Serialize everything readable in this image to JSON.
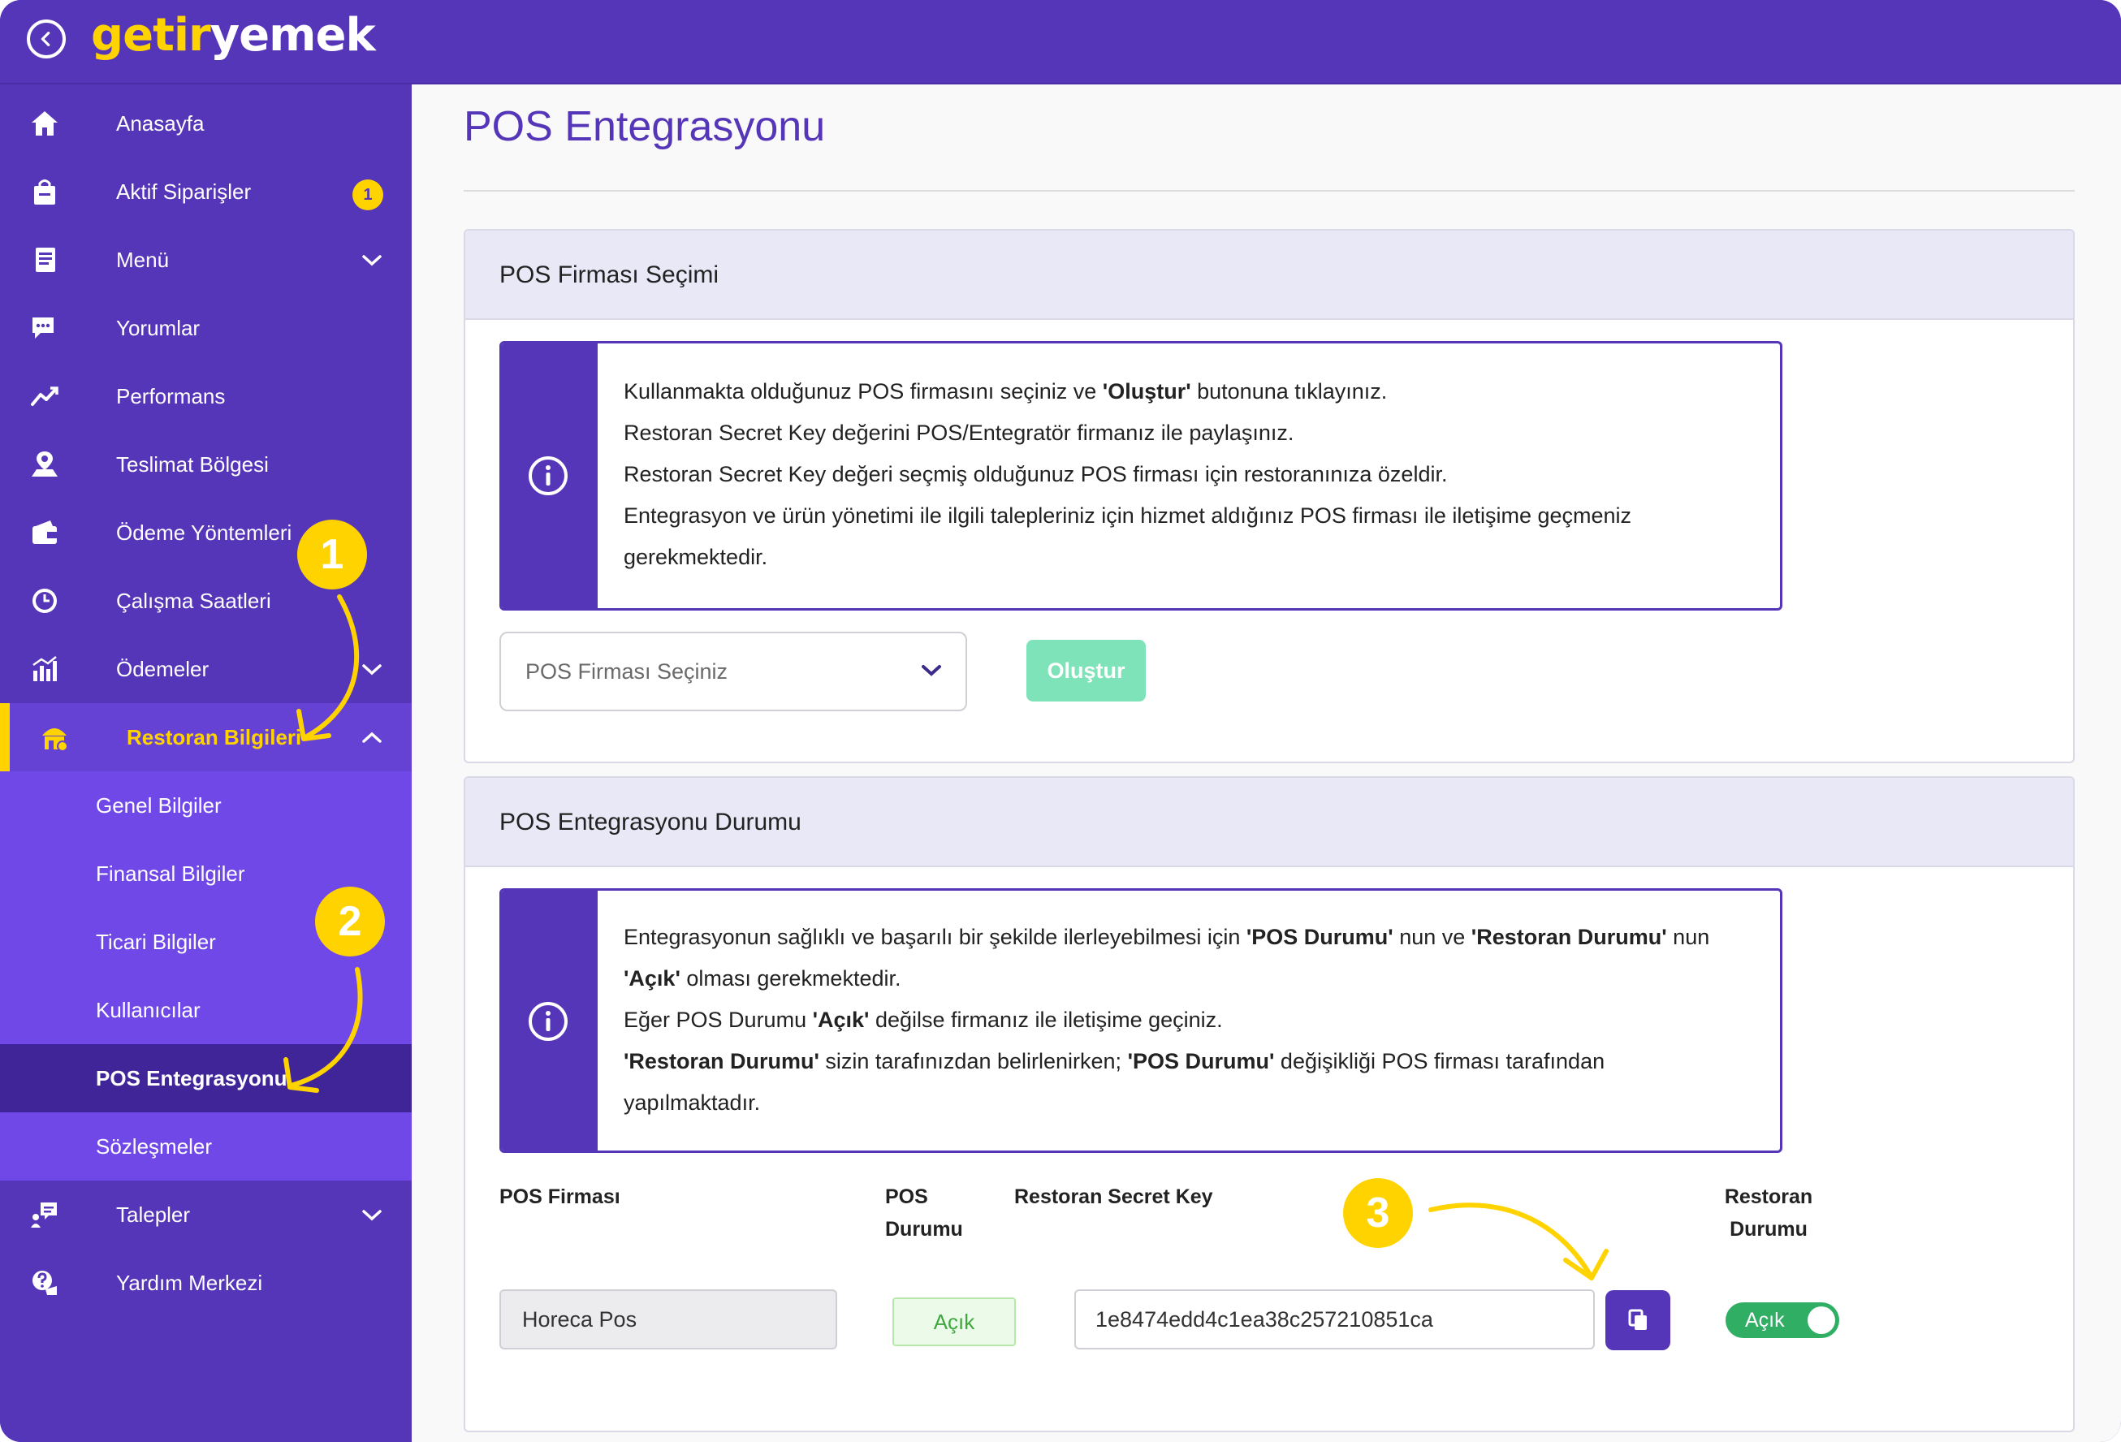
{
  "app": {
    "logo_part1": "getir",
    "logo_part2": "yemek"
  },
  "sidebar": {
    "items": [
      {
        "label": "Anasayfa",
        "icon": "home-icon"
      },
      {
        "label": "Aktif Siparişler",
        "icon": "shopping-bag-icon",
        "badge": "1"
      },
      {
        "label": "Menü",
        "icon": "menu-book-icon"
      },
      {
        "label": "Yorumlar",
        "icon": "comments-icon"
      },
      {
        "label": "Performans",
        "icon": "trend-icon"
      },
      {
        "label": "Teslimat Bölgesi",
        "icon": "delivery-area-icon"
      },
      {
        "label": "Ödeme Yöntemleri",
        "icon": "wallet-icon"
      },
      {
        "label": "Çalışma Saatleri",
        "icon": "clock-icon"
      },
      {
        "label": "Ödemeler",
        "icon": "chart-bars-icon"
      },
      {
        "label": "Restoran Bilgileri",
        "icon": "restaurant-icon"
      },
      {
        "label": "Talepler",
        "icon": "requests-icon"
      },
      {
        "label": "Yardım Merkezi",
        "icon": "help-icon"
      }
    ],
    "sub_items": [
      {
        "label": "Genel Bilgiler"
      },
      {
        "label": "Finansal Bilgiler"
      },
      {
        "label": "Ticari Bilgiler"
      },
      {
        "label": "Kullanıcılar"
      },
      {
        "label": "POS Entegrasyonu"
      },
      {
        "label": "Sözleşmeler"
      }
    ]
  },
  "page": {
    "title": "POS Entegrasyonu"
  },
  "selection_card": {
    "title": "POS Firması Seçimi",
    "info_lines": [
      {
        "pre": "Kullanmakta olduğunuz POS firmasını seçiniz ve ",
        "bold": "'Oluştur'",
        "post": " butonuna tıklayınız."
      },
      {
        "text": "Restoran Secret Key değerini POS/Entegratör firmanız ile paylaşınız."
      },
      {
        "text": "Restoran Secret Key değeri seçmiş olduğunuz POS firması için restoranınıza özeldir."
      },
      {
        "text": "Entegrasyon ve ürün yönetimi ile ilgili talepleriniz için hizmet aldığınız POS firması ile iletişime geçmeniz"
      },
      {
        "text": "gerekmektedir."
      }
    ],
    "select_placeholder": "POS Firması Seçiniz",
    "create_button": "Oluştur"
  },
  "status_card": {
    "title": "POS Entegrasyonu Durumu",
    "info": {
      "l1_pre": "Entegrasyonun sağlıklı ve başarılı bir şekilde ilerleyebilmesi için ",
      "l1_b1": "'POS Durumu'",
      "l1_mid": " nun ve ",
      "l1_b2": "'Restoran Durumu'",
      "l1_post": " nun",
      "l2_b": "'Açık'",
      "l2_post": " olması gerekmektedir.",
      "l3_pre": "Eğer POS Durumu ",
      "l3_b": "'Açık'",
      "l3_post": " değilse firmanız ile iletişime geçiniz.",
      "l4_b1": "'Restoran Durumu'",
      "l4_mid": " sizin tarafınızdan belirlenirken; ",
      "l4_b2": "'POS Durumu'",
      "l4_post": " değişikliği POS firması tarafından",
      "l5": "yapılmaktadır."
    },
    "columns": {
      "firm": "POS Firması",
      "pos_status_1": "POS",
      "pos_status_2": "Durumu",
      "secret_key": "Restoran Secret Key",
      "restaurant_status_1": "Restoran",
      "restaurant_status_2": "Durumu"
    },
    "row": {
      "firm": "Horeca Pos",
      "pos_status": "Açık",
      "secret_key": "1e8474edd4c1ea38c257210851ca",
      "restaurant_status": "Açık",
      "restaurant_status_on": true
    }
  },
  "annotations": [
    "1",
    "2",
    "3"
  ],
  "colors": {
    "brand_purple": "#5535b8",
    "brand_yellow": "#ffd300",
    "success_green": "#2fae64",
    "create_button": "#7fe3b9"
  }
}
